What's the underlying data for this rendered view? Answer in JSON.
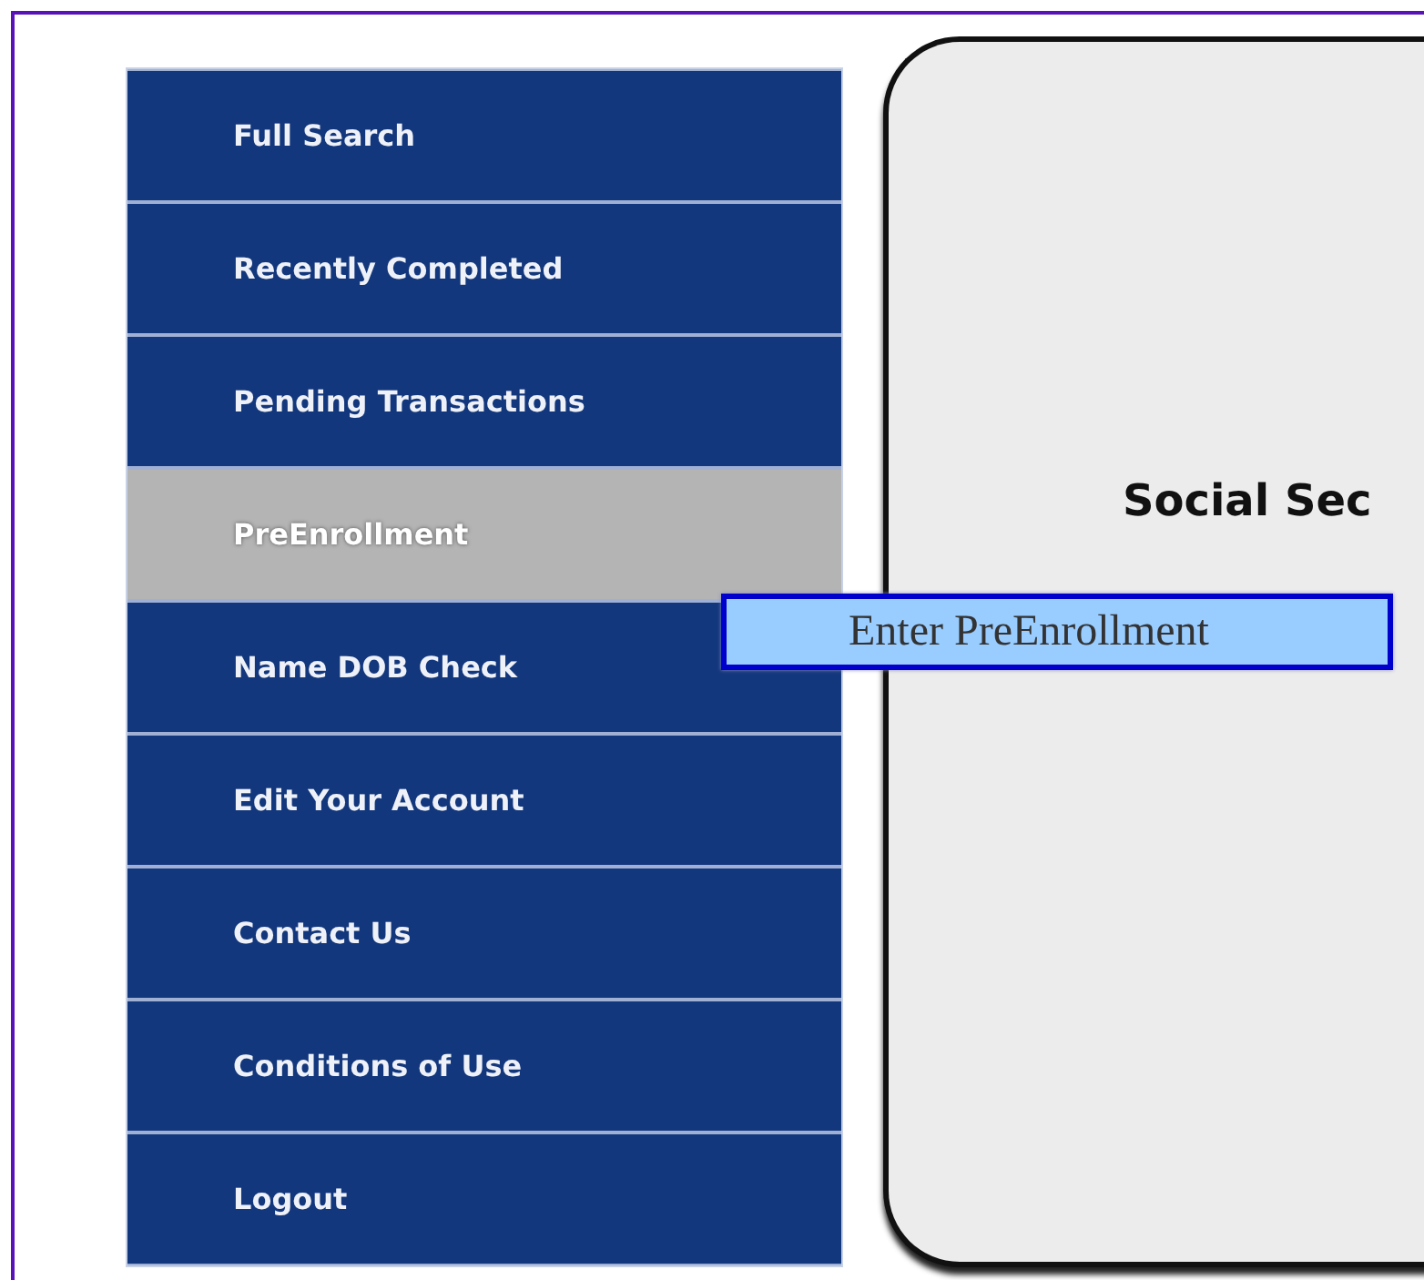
{
  "menu": {
    "items": [
      {
        "label": "Full Search",
        "selected": false
      },
      {
        "label": "Recently Completed",
        "selected": false
      },
      {
        "label": "Pending Transactions",
        "selected": false
      },
      {
        "label": "PreEnrollment",
        "selected": true
      },
      {
        "label": "Name DOB Check",
        "selected": false
      },
      {
        "label": "Edit Your Account",
        "selected": false
      },
      {
        "label": "Contact Us",
        "selected": false
      },
      {
        "label": "Conditions of Use",
        "selected": false
      },
      {
        "label": "Logout",
        "selected": false
      }
    ]
  },
  "panel": {
    "heading": "Social Sec"
  },
  "tooltip": {
    "text": "Enter PreEnrollment"
  }
}
